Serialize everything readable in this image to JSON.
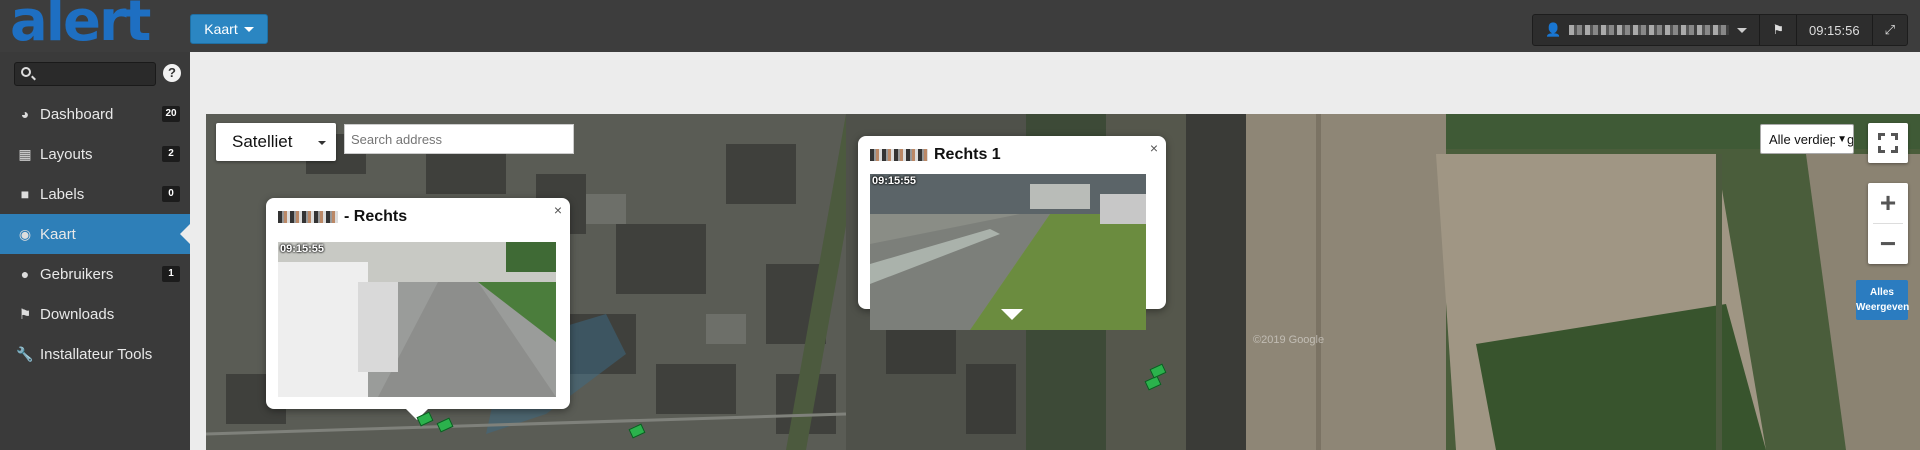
{
  "app": {
    "logo": "alert"
  },
  "header": {
    "view_button": "Kaart",
    "user_name": "",
    "time": "09:15:56"
  },
  "sidebar": {
    "help_label": "?",
    "items": [
      {
        "label": "Dashboard",
        "icon": "dashboard-icon",
        "badge": "20"
      },
      {
        "label": "Layouts",
        "icon": "grid-icon",
        "badge": "2"
      },
      {
        "label": "Labels",
        "icon": "video-camera-icon",
        "badge": "0"
      },
      {
        "label": "Kaart",
        "icon": "globe-icon",
        "badge": "",
        "active": true
      },
      {
        "label": "Gebruikers",
        "icon": "users-icon",
        "badge": "1"
      },
      {
        "label": "Downloads",
        "icon": "flag-icon",
        "badge": ""
      },
      {
        "label": "Installateur Tools",
        "icon": "wrench-icon",
        "badge": ""
      }
    ]
  },
  "map": {
    "type_selected": "Satelliet",
    "search_placeholder": "Search address",
    "floor_selected": "Alle verdiepingen",
    "zoom_in": "+",
    "zoom_out": "−",
    "show_all": "Alles Weergeven",
    "copyright": "©2019 Google",
    "popups": [
      {
        "title_suffix": "- Rechts",
        "timestamp": "09:15:55",
        "close": "×"
      },
      {
        "title_suffix": "Rechts 1",
        "timestamp": "09:15:55",
        "close": "×"
      }
    ]
  },
  "colors": {
    "accent": "#2e7fb8",
    "logo": "#1e6fc2",
    "camera_marker": "#2bb24c"
  }
}
